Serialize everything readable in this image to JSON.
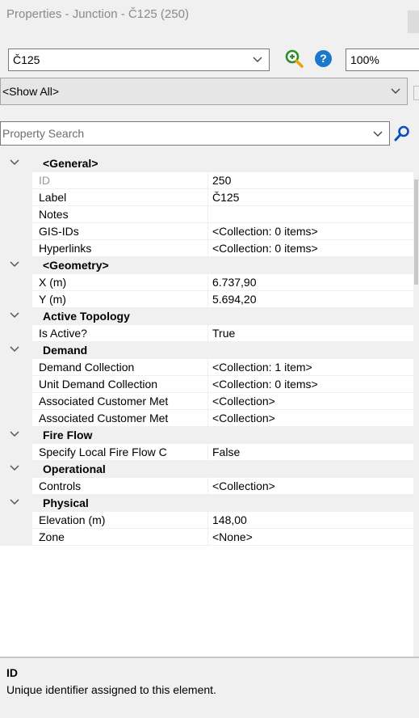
{
  "window": {
    "title": "Properties - Junction - Č125 (250)"
  },
  "toolbar": {
    "element_value": "Č125",
    "zoom_icon": "zoom-in-icon",
    "help_icon": "help-icon",
    "zoom_value": "100%"
  },
  "filter": {
    "value": "<Show All>"
  },
  "search": {
    "placeholder": "Property Search",
    "icon": "search-icon"
  },
  "grid": {
    "rows": [
      {
        "type": "category",
        "label": "<General>"
      },
      {
        "type": "property",
        "name": "ID",
        "value": "250",
        "readonly": true
      },
      {
        "type": "property",
        "name": "Label",
        "value": "Č125"
      },
      {
        "type": "property",
        "name": "Notes",
        "value": ""
      },
      {
        "type": "property",
        "name": "GIS-IDs",
        "value": "<Collection: 0 items>"
      },
      {
        "type": "property",
        "name": "Hyperlinks",
        "value": "<Collection: 0 items>"
      },
      {
        "type": "category",
        "label": "<Geometry>"
      },
      {
        "type": "property",
        "name": "X (m)",
        "value": "6.737,90"
      },
      {
        "type": "property",
        "name": "Y (m)",
        "value": "5.694,20"
      },
      {
        "type": "category",
        "label": "Active Topology"
      },
      {
        "type": "property",
        "name": "Is Active?",
        "value": "True"
      },
      {
        "type": "category",
        "label": "Demand"
      },
      {
        "type": "property",
        "name": "Demand Collection",
        "value": "<Collection: 1 item>"
      },
      {
        "type": "property",
        "name": "Unit Demand Collection",
        "value": "<Collection: 0 items>"
      },
      {
        "type": "property",
        "name": "Associated Customer Met",
        "value": "<Collection>"
      },
      {
        "type": "property",
        "name": "Associated Customer Met",
        "value": "<Collection>"
      },
      {
        "type": "category",
        "label": "Fire Flow"
      },
      {
        "type": "property",
        "name": "Specify Local Fire Flow C",
        "value": "False"
      },
      {
        "type": "category",
        "label": "Operational"
      },
      {
        "type": "property",
        "name": "Controls",
        "value": "<Collection>"
      },
      {
        "type": "category",
        "label": "Physical"
      },
      {
        "type": "property",
        "name": "Elevation (m)",
        "value": "148,00"
      },
      {
        "type": "property",
        "name": "Zone",
        "value": "<None>"
      }
    ]
  },
  "description": {
    "title": "ID",
    "text": "Unique identifier assigned to this element."
  },
  "colors": {
    "help_blue": "#1c78c9",
    "search_blue": "#0a4fbf",
    "zoom_orange": "#e8a400",
    "zoom_green": "#2e8b2e"
  }
}
